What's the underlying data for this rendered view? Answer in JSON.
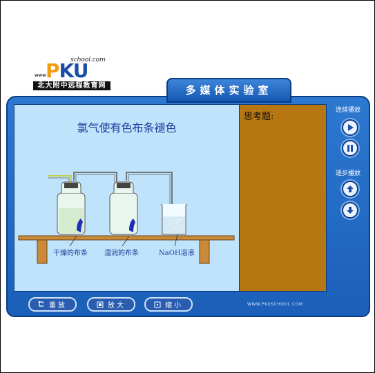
{
  "logo": {
    "school": "school.com",
    "www": "www",
    "pku_a": "P",
    "pku_b": "KU",
    "band": "北大附中远程教育网"
  },
  "app": {
    "title": "多媒体实验室"
  },
  "stage": {
    "title": "氯气使有色布条褪色",
    "labels": {
      "dry": "干燥的布条",
      "wet": "湿润的布条",
      "naoh": "NaOH溶液"
    }
  },
  "notes": {
    "title": "思考题:"
  },
  "controls": {
    "continuous_label": "连续播放",
    "step_label": "逐步播放",
    "play_icon": "play-icon",
    "pause_icon": "pause-icon",
    "up_icon": "arrow-up-icon",
    "down_icon": "arrow-down-icon"
  },
  "toolbar": {
    "replay": "重放",
    "zoom_in": "放大",
    "zoom_out": "缩小"
  },
  "footer": {
    "url": "WWW.PKUSCHOOL.COM"
  },
  "colors": {
    "frame": "#1b5fb8",
    "stage": "#bfe3fb",
    "notes": "#b67712"
  }
}
